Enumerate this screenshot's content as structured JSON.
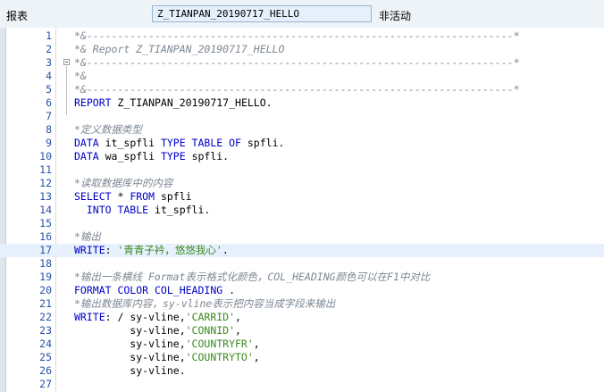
{
  "header": {
    "type_label": "报表",
    "program_name": "Z_TIANPAN_20190717_HELLO",
    "status": "非活动"
  },
  "editor": {
    "lines": [
      {
        "n": "1",
        "hl": false,
        "tokens": [
          {
            "t": "*&---------------------------------------------------------------------*",
            "c": "cmt"
          }
        ]
      },
      {
        "n": "2",
        "hl": false,
        "tokens": [
          {
            "t": "*& Report Z_TIANPAN_20190717_HELLO",
            "c": "cmt"
          }
        ]
      },
      {
        "n": "3",
        "hl": false,
        "tokens": [
          {
            "t": "*&---------------------------------------------------------------------*",
            "c": "cmt"
          }
        ]
      },
      {
        "n": "4",
        "hl": false,
        "tokens": [
          {
            "t": "*&",
            "c": "cmt"
          }
        ]
      },
      {
        "n": "5",
        "hl": false,
        "tokens": [
          {
            "t": "*&---------------------------------------------------------------------*",
            "c": "cmt"
          }
        ]
      },
      {
        "n": "6",
        "hl": false,
        "tokens": [
          {
            "t": "REPORT ",
            "c": "kw"
          },
          {
            "t": "Z_TIANPAN_20190717_HELLO.",
            "c": "plain"
          }
        ]
      },
      {
        "n": "7",
        "hl": false,
        "tokens": []
      },
      {
        "n": "8",
        "hl": false,
        "tokens": [
          {
            "t": "*定义数据类型",
            "c": "cmt"
          }
        ]
      },
      {
        "n": "9",
        "hl": false,
        "tokens": [
          {
            "t": "DATA ",
            "c": "kw"
          },
          {
            "t": "it_spfli ",
            "c": "plain"
          },
          {
            "t": "TYPE TABLE OF ",
            "c": "kw"
          },
          {
            "t": "spfli.",
            "c": "plain"
          }
        ]
      },
      {
        "n": "10",
        "hl": false,
        "tokens": [
          {
            "t": "DATA ",
            "c": "kw"
          },
          {
            "t": "wa_spfli ",
            "c": "plain"
          },
          {
            "t": "TYPE ",
            "c": "kw"
          },
          {
            "t": "spfli.",
            "c": "plain"
          }
        ]
      },
      {
        "n": "11",
        "hl": false,
        "tokens": []
      },
      {
        "n": "12",
        "hl": false,
        "tokens": [
          {
            "t": "*读取数据库中的内容",
            "c": "cmt"
          }
        ]
      },
      {
        "n": "13",
        "hl": false,
        "tokens": [
          {
            "t": "SELECT ",
            "c": "kw"
          },
          {
            "t": "* ",
            "c": "plain"
          },
          {
            "t": "FROM ",
            "c": "kw"
          },
          {
            "t": "spfli",
            "c": "plain"
          }
        ]
      },
      {
        "n": "14",
        "hl": false,
        "tokens": [
          {
            "t": "  INTO TABLE ",
            "c": "kw"
          },
          {
            "t": "it_spfli.",
            "c": "plain"
          }
        ]
      },
      {
        "n": "15",
        "hl": false,
        "tokens": []
      },
      {
        "n": "16",
        "hl": false,
        "tokens": [
          {
            "t": "*输出",
            "c": "cmt"
          }
        ]
      },
      {
        "n": "17",
        "hl": true,
        "tokens": [
          {
            "t": "WRITE",
            "c": "kw"
          },
          {
            "t": ": ",
            "c": "plain"
          },
          {
            "t": "'青青子衿，悠悠我心'",
            "c": "str"
          },
          {
            "t": ".",
            "c": "plain"
          }
        ]
      },
      {
        "n": "18",
        "hl": false,
        "tokens": []
      },
      {
        "n": "19",
        "hl": false,
        "tokens": [
          {
            "t": "*输出一条横线 Format表示格式化颜色，COL_HEADING颜色可以在F1中对比",
            "c": "cmt"
          }
        ]
      },
      {
        "n": "20",
        "hl": false,
        "tokens": [
          {
            "t": "FORMAT COLOR COL_HEADING ",
            "c": "kw"
          },
          {
            "t": ".",
            "c": "plain"
          }
        ]
      },
      {
        "n": "21",
        "hl": false,
        "tokens": [
          {
            "t": "*输出数据库内容，sy-vline表示把内容当成字段来输出",
            "c": "cmt"
          }
        ]
      },
      {
        "n": "22",
        "hl": false,
        "tokens": [
          {
            "t": "WRITE",
            "c": "kw"
          },
          {
            "t": ": / sy-vline,",
            "c": "plain"
          },
          {
            "t": "'CARRID'",
            "c": "str"
          },
          {
            "t": ",",
            "c": "plain"
          }
        ]
      },
      {
        "n": "23",
        "hl": false,
        "tokens": [
          {
            "t": "         sy-vline,",
            "c": "plain"
          },
          {
            "t": "'CONNID'",
            "c": "str"
          },
          {
            "t": ",",
            "c": "plain"
          }
        ]
      },
      {
        "n": "24",
        "hl": false,
        "tokens": [
          {
            "t": "         sy-vline,",
            "c": "plain"
          },
          {
            "t": "'COUNTRYFR'",
            "c": "str"
          },
          {
            "t": ",",
            "c": "plain"
          }
        ]
      },
      {
        "n": "25",
        "hl": false,
        "tokens": [
          {
            "t": "         sy-vline,",
            "c": "plain"
          },
          {
            "t": "'COUNTRYTO'",
            "c": "str"
          },
          {
            "t": ",",
            "c": "plain"
          }
        ]
      },
      {
        "n": "26",
        "hl": false,
        "tokens": [
          {
            "t": "         sy-vline.",
            "c": "plain"
          }
        ]
      },
      {
        "n": "27",
        "hl": false,
        "tokens": []
      }
    ]
  }
}
